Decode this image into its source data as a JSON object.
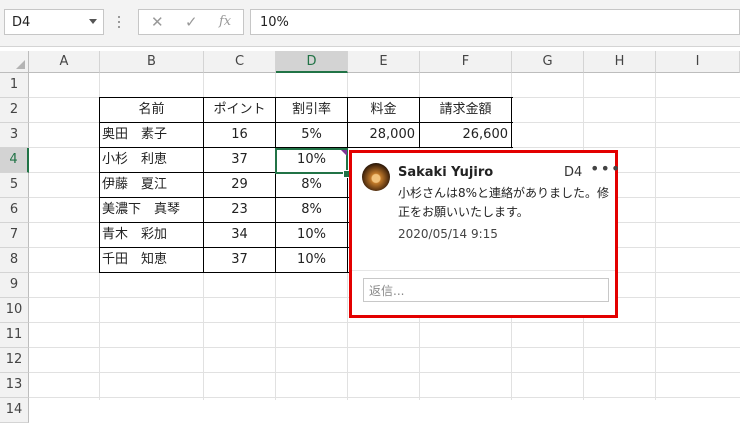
{
  "formula_bar": {
    "name_box": "D4",
    "cancel_icon": "✕",
    "enter_icon": "✓",
    "fx_icon": "fx",
    "formula": "10%"
  },
  "columns": [
    "A",
    "B",
    "C",
    "D",
    "E",
    "F",
    "G",
    "H",
    "I"
  ],
  "selected_column": "D",
  "rows": [
    "1",
    "2",
    "3",
    "4",
    "5",
    "6",
    "7",
    "8",
    "9",
    "10",
    "11",
    "12",
    "13",
    "14"
  ],
  "selected_row": "4",
  "table": {
    "headers": [
      "名前",
      "ポイント",
      "割引率",
      "料金",
      "請求金額"
    ],
    "rows": [
      {
        "name": "奥田　素子",
        "points": "16",
        "discount": "5%",
        "fee": "28,000",
        "billing": "26,600"
      },
      {
        "name": "小杉　利恵",
        "points": "37",
        "discount": "10%",
        "fee": "",
        "billing": ""
      },
      {
        "name": "伊藤　夏江",
        "points": "29",
        "discount": "8%",
        "fee": "",
        "billing": ""
      },
      {
        "name": "美濃下　真琴",
        "points": "23",
        "discount": "8%",
        "fee": "",
        "billing": ""
      },
      {
        "name": "青木　彩加",
        "points": "34",
        "discount": "10%",
        "fee": "",
        "billing": ""
      },
      {
        "name": "千田　知恵",
        "points": "37",
        "discount": "10%",
        "fee": "",
        "billing": ""
      }
    ]
  },
  "comment": {
    "author": "Sakaki Yujiro",
    "cell_ref": "D4",
    "more": "•••",
    "text": "小杉さんは8%と連絡がありました。修正をお願いいたします。",
    "date": "2020/05/14 9:15",
    "reply_placeholder": "返信...",
    "border_color": "#e30000"
  },
  "colors": {
    "accent": "#217346",
    "comment_marker": "#7e3794"
  }
}
